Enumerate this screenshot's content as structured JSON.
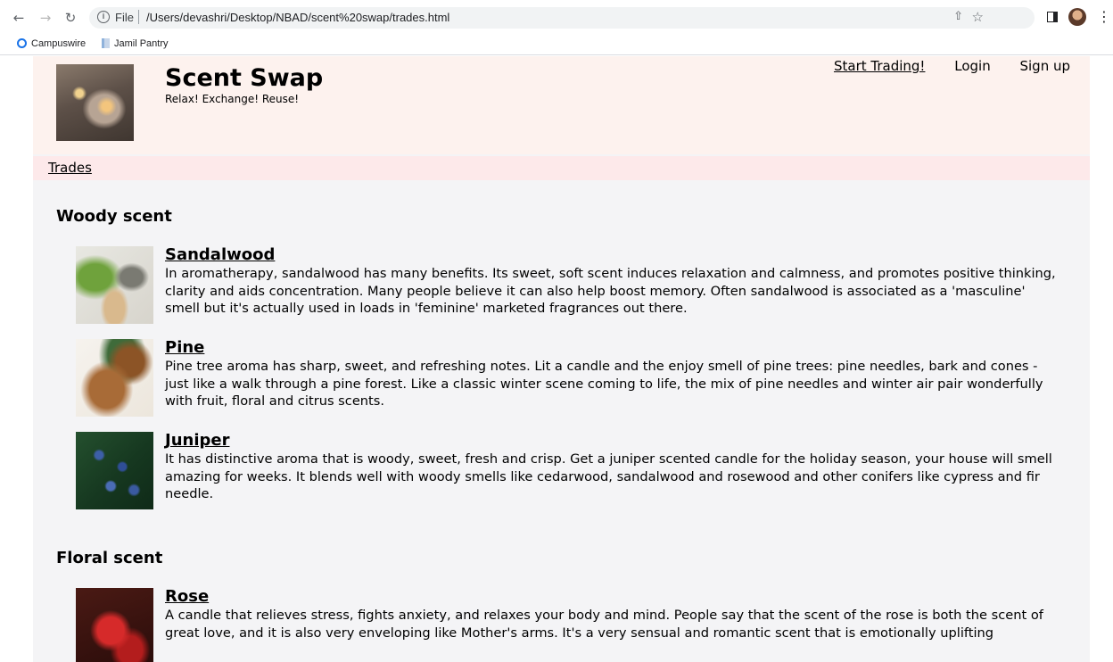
{
  "browser": {
    "scheme_label": "File",
    "url": "/Users/devashri/Desktop/NBAD/scent%20swap/trades.html",
    "bookmarks": [
      {
        "label": "Campuswire",
        "icon": "campuswire-icon"
      },
      {
        "label": "Jamil Pantry",
        "icon": "page-icon"
      }
    ]
  },
  "site": {
    "title": "Scent Swap",
    "tagline": "Relax! Exchange! Reuse!",
    "nav": {
      "start_trading": "Start Trading!",
      "login": "Login",
      "signup": "Sign up"
    },
    "subnav": {
      "trades": "Trades"
    }
  },
  "categories": [
    {
      "title": "Woody scent",
      "items": [
        {
          "name": "Sandalwood",
          "description": "In aromatherapy, sandalwood has many benefits. Its sweet, soft scent induces relaxation and calmness, and promotes positive thinking, clarity and aids concentration. Many people believe it can also help boost memory. Often sandalwood is associated as a 'masculine' smell but it's actually used in loads in 'feminine' marketed fragrances out there."
        },
        {
          "name": "Pine",
          "description": "Pine tree aroma has sharp, sweet, and refreshing notes. Lit a candle and the enjoy smell of pine trees: pine needles, bark and cones - just like a walk through a pine forest. Like a classic winter scene coming to life, the mix of pine needles and winter air pair wonderfully with fruit, floral and citrus scents."
        },
        {
          "name": "Juniper",
          "description": "It has distinctive aroma that is woody, sweet, fresh and crisp. Get a juniper scented candle for the holiday season, your house will smell amazing for weeks. It blends well with woody smells like cedarwood, sandalwood and rosewood and other conifers like cypress and fir needle."
        }
      ]
    },
    {
      "title": "Floral scent",
      "items": [
        {
          "name": "Rose",
          "description": "A candle that relieves stress, fights anxiety, and relaxes your body and mind. People say that the scent of the rose is both the scent of great love, and it is also very enveloping like Mother's arms. It's a very sensual and romantic scent that is emotionally uplifting"
        }
      ]
    }
  ],
  "colors": {
    "header_bg": "#fdf2ee",
    "subnav_bg": "#fde9ea",
    "content_bg": "#f4f4f6"
  }
}
